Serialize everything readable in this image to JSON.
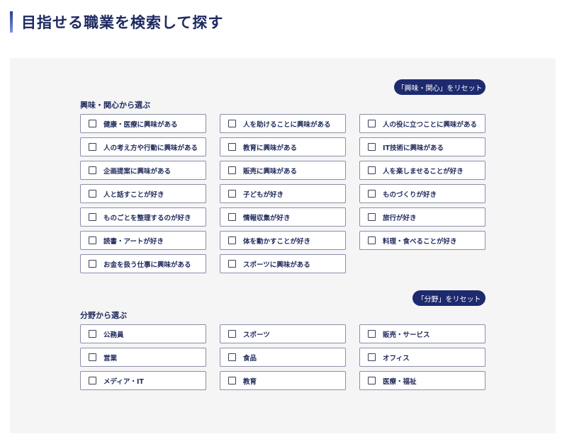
{
  "page_title": "目指せる職業を検索して探す",
  "interest_section": {
    "label": "興味・関心から選ぶ",
    "reset_label": "「興味・関心」をリセット",
    "options": [
      "健康・医療に興味がある",
      "人を助けることに興味がある",
      "人の役に立つことに興味がある",
      "人の考え方や行動に興味がある",
      "教育に興味がある",
      "IT技術に興味がある",
      "企画提案に興味がある",
      "販売に興味がある",
      "人を楽しませることが好き",
      "人と話すことが好き",
      "子どもが好き",
      "ものづくりが好き",
      "ものごとを整理するのが好き",
      "情報収集が好き",
      "旅行が好き",
      "読書・アートが好き",
      "体を動かすことが好き",
      "料理・食べることが好き",
      "お金を扱う仕事に興味がある",
      "スポーツに興味がある"
    ]
  },
  "field_section": {
    "label": "分野から選ぶ",
    "reset_label": "「分野」をリセット",
    "options": [
      "公務員",
      "スポーツ",
      "販売・サービス",
      "営業",
      "食品",
      "オフィス",
      "メディア・IT",
      "教育",
      "医療・福祉"
    ]
  }
}
